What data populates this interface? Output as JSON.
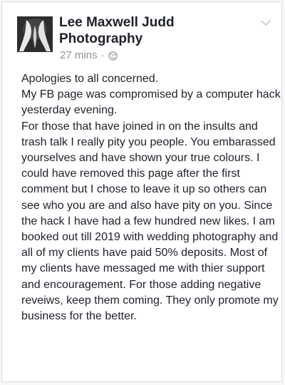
{
  "post": {
    "author": "Lee Maxwell Judd Photography",
    "time": "27 mins",
    "separator": "·",
    "privacy_icon": "globe-icon",
    "options_icon": "chevron-down-icon",
    "body": "Apologies to all concerned.\nMy FB page was compromised by a computer hack yesterday evening.\nFor those that have joined in on the insults and trash talk I really pity you people. You embarassed yourselves and have shown your true colours. I could have removed this page after the first comment but I chose to leave it up so others can see who you are and also have pity on you. Since the hack I have had a few hundred new likes. I am booked out till 2019 with wedding photography and all of my clients have paid 50% deposits. Most of my clients have messaged me with thier support and encouragement. For those adding negative reveiws, keep them coming. They only promote my business for the better."
  },
  "colors": {
    "text": "#1d2129",
    "meta": "#90949c",
    "border": "#d8dbe0",
    "background": "#ffffff"
  }
}
